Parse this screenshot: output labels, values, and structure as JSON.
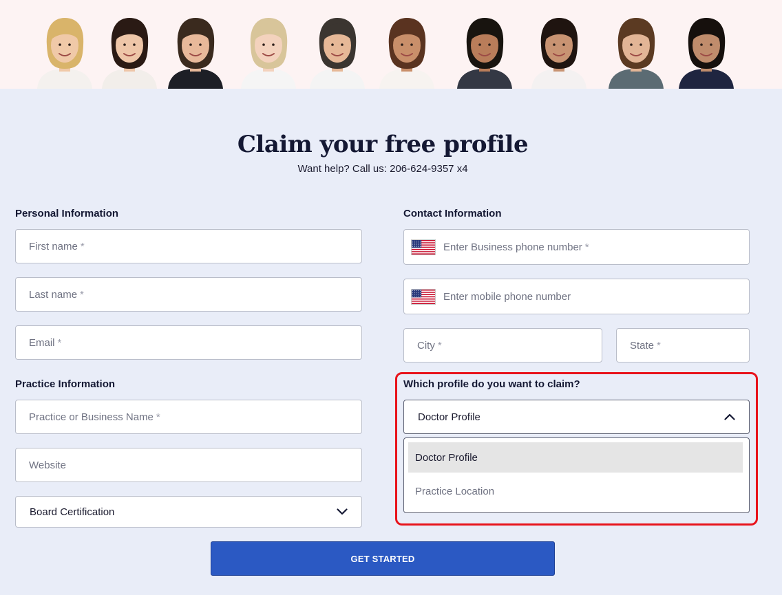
{
  "header": {
    "title": "Claim your free profile",
    "help_text": "Want help? Call us: 206-624-9357 x4"
  },
  "banner": {
    "headshots": [
      {
        "hair": "#d9b46a",
        "skin": "#f0c9a8",
        "clothes": "#f4f1ee"
      },
      {
        "hair": "#2a1a14",
        "skin": "#eec6a8",
        "clothes": "#f2eeea"
      },
      {
        "hair": "#3a2a1e",
        "skin": "#e8b99a",
        "clothes": "#1d1f26"
      },
      {
        "hair": "#d8c59a",
        "skin": "#f3d2bd",
        "clothes": "#f5f5f5"
      },
      {
        "hair": "#3b3530",
        "skin": "#e6b897",
        "clothes": "#f4f4f4"
      },
      {
        "hair": "#5a3320",
        "skin": "#c98f6a",
        "clothes": "#f7f3f0"
      },
      {
        "hair": "#18140f",
        "skin": "#b97d5a",
        "clothes": "#343844"
      },
      {
        "hair": "#1f1410",
        "skin": "#c89372",
        "clothes": "#f4f1f1"
      },
      {
        "hair": "#5b3a22",
        "skin": "#e2b596",
        "clothes": "#5b6b73"
      },
      {
        "hair": "#16100d",
        "skin": "#c08c6c",
        "clothes": "#1f2540"
      }
    ]
  },
  "personal": {
    "label": "Personal Information",
    "first_name": "First name",
    "last_name": "Last name",
    "email": "Email",
    "required_mark": "*"
  },
  "practice": {
    "label": "Practice Information",
    "business_name": "Practice or Business Name",
    "website": "Website",
    "board_certification": "Board Certification"
  },
  "contact": {
    "label": "Contact Information",
    "business_phone": "Enter Business phone number",
    "mobile_phone": "Enter mobile phone number",
    "city": "City",
    "state": "State"
  },
  "profile": {
    "label": "Which profile do you want to claim?",
    "selected": "Doctor Profile",
    "options": [
      "Doctor Profile",
      "Practice Location"
    ]
  },
  "cta": {
    "label": "GET STARTED"
  },
  "colors": {
    "background": "#e9edf8",
    "banner": "#fdf3f3",
    "primary_button": "#2b59c3",
    "highlight_border": "#e8131b"
  }
}
